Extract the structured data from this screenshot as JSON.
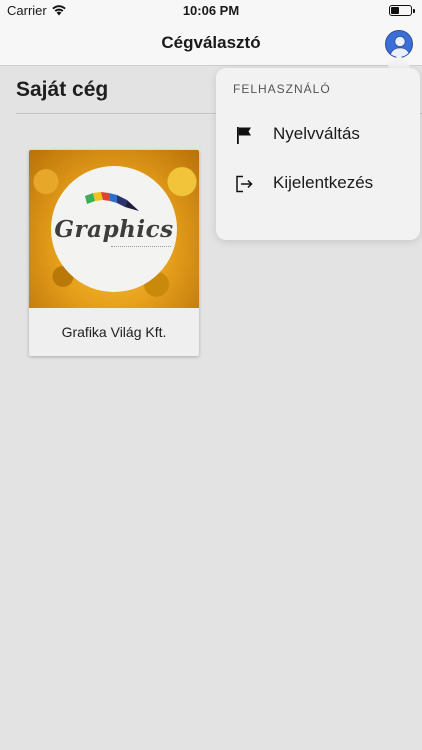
{
  "status_bar": {
    "carrier": "Carrier",
    "time": "10:06 PM",
    "wifi_icon": "wifi-icon",
    "battery_icon": "battery-icon"
  },
  "nav": {
    "title": "Cégválasztó",
    "avatar_icon": "user-avatar-icon"
  },
  "section": {
    "title": "Saját cég"
  },
  "companies": [
    {
      "name": "Grafika Világ Kft.",
      "logo_text": "Graphics"
    }
  ],
  "user_menu": {
    "header": "FELHASZNÁLÓ",
    "items": [
      {
        "label": "Nyelvváltás",
        "icon": "flag-icon"
      },
      {
        "label": "Kijelentkezés",
        "icon": "logout-icon"
      }
    ]
  },
  "colors": {
    "background": "#e3e3e3",
    "bar": "#f7f7f7",
    "menu": "#f2f2f2",
    "avatar": "#3b6fd6"
  }
}
